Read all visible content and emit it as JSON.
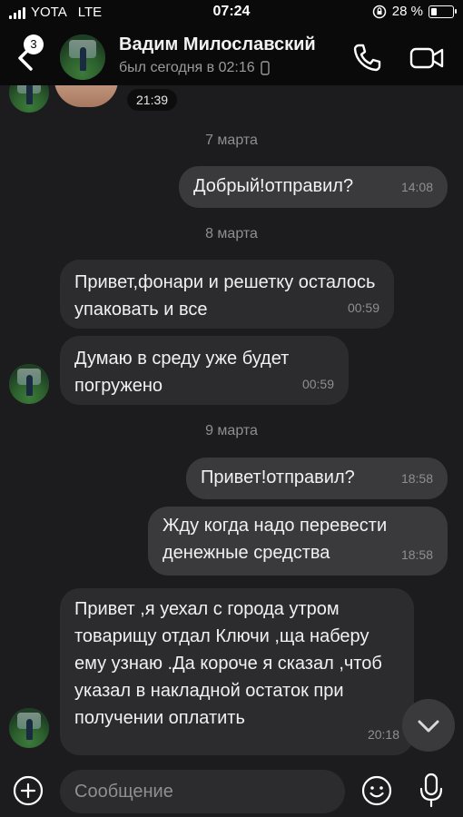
{
  "status_bar": {
    "carrier": "YOTA",
    "network": "LTE",
    "time": "07:24",
    "battery_percent": "28 %",
    "battery_level": 0.28
  },
  "header": {
    "unread_badge": "3",
    "contact_name": "Вадим Милославский",
    "last_seen": "был сегодня в 02:16"
  },
  "chat": {
    "prev_image_time": "21:39",
    "sections": [
      {
        "date": "7 марта",
        "messages": [
          {
            "direction": "out",
            "text": "Добрый!отправил?",
            "time": "14:08"
          }
        ]
      },
      {
        "date": "8 марта",
        "messages": [
          {
            "direction": "in",
            "text": "Привет,фонари и решетку осталось упаковать и все",
            "time": "00:59"
          },
          {
            "direction": "in",
            "text": "Думаю в среду уже будет погружено",
            "time": "00:59"
          }
        ]
      },
      {
        "date": "9 марта",
        "messages": [
          {
            "direction": "out",
            "text": "Привет!отправил?",
            "time": "18:58"
          },
          {
            "direction": "out",
            "text": "Жду когда надо перевести денежные средства",
            "time": "18:58"
          },
          {
            "direction": "in",
            "text": "Привет ,я уехал с города утром товарищу отдал Ключи ,ща наберу ему узнаю .Да короче я сказал ,чтоб указал в накладной остаток при получении оплатить",
            "time": "20:18"
          }
        ]
      }
    ]
  },
  "input_bar": {
    "placeholder": "Сообщение"
  },
  "colors": {
    "background": "#1c1c1e",
    "incoming_bubble": "#2c2c2e",
    "outgoing_bubble": "#3a3a3c",
    "secondary_text": "#8e8e93"
  }
}
